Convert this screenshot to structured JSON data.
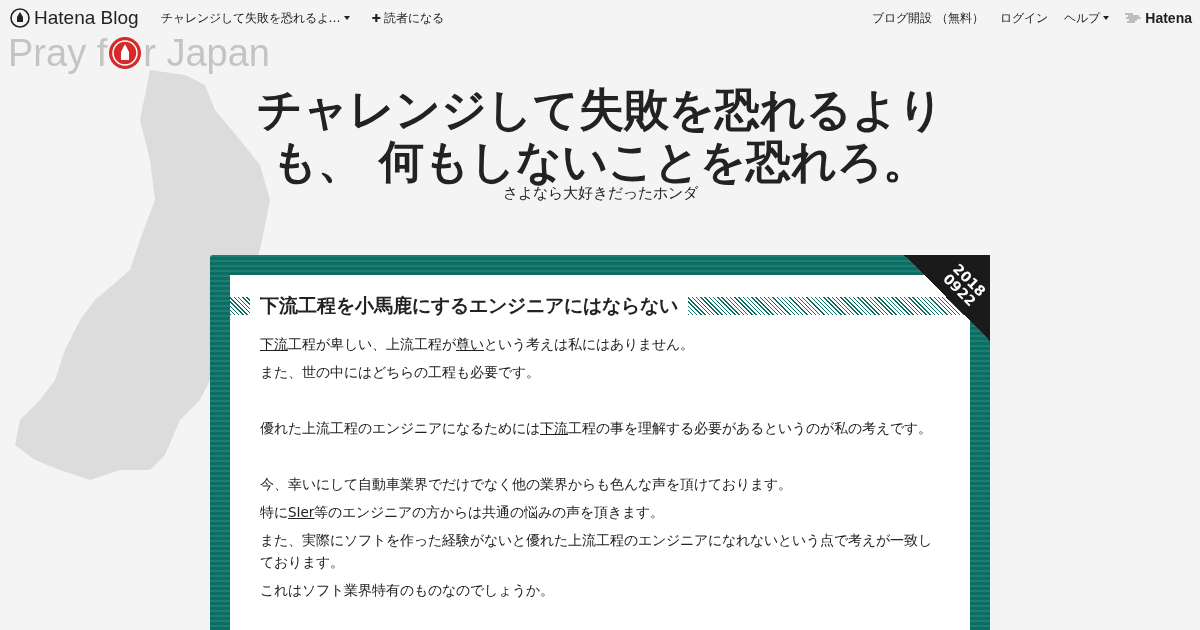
{
  "topbar": {
    "brand": "Hatena Blog",
    "blog_menu": "チャレンジして失敗を恐れるよ…",
    "subscribe_icon": "✚",
    "subscribe": "読者になる",
    "right_links": [
      "ブログ開設 （無料）",
      "ログイン"
    ],
    "help": "ヘルプ",
    "hatena": "Hatena"
  },
  "pray_logo": {
    "before": "Pray f",
    "after": "r Japan"
  },
  "blog_title": "チャレンジして失敗を恐れるよりも、 何もしないことを恐れろ。",
  "blog_description": "さよなら大好きだったホンダ",
  "entry": {
    "date_year": "2018",
    "date_day": "0922",
    "title": "下流工程を小馬鹿にするエンジニアにはならない",
    "paragraphs": [
      {
        "kind": "text",
        "parts": [
          {
            "text": "下流",
            "kind": "link"
          },
          {
            "text": "工程が卑しい、上流工程が",
            "kind": "plain"
          },
          {
            "text": "尊い",
            "kind": "link"
          },
          {
            "text": "という考えは私にはありません。",
            "kind": "plain"
          }
        ]
      },
      {
        "kind": "text",
        "parts": [
          {
            "text": "また、世の中にはどちらの工程も必要です。",
            "kind": "plain"
          }
        ]
      },
      {
        "kind": "blank"
      },
      {
        "kind": "text",
        "parts": [
          {
            "text": "優れた上流工程のエンジニアになるためには",
            "kind": "plain"
          },
          {
            "text": "下流",
            "kind": "link"
          },
          {
            "text": "工程の事を理解する必要があるというのが私の考えです。",
            "kind": "plain"
          }
        ]
      },
      {
        "kind": "blank"
      },
      {
        "kind": "text",
        "parts": [
          {
            "text": "今、幸いにして自動車業界でだけでなく他の業界からも色んな声を頂けております。",
            "kind": "plain"
          }
        ]
      },
      {
        "kind": "text",
        "parts": [
          {
            "text": "特に",
            "kind": "plain"
          },
          {
            "text": "SIer",
            "kind": "link"
          },
          {
            "text": "等のエンジニアの方からは共通の悩みの声を頂きます。",
            "kind": "plain"
          }
        ]
      },
      {
        "kind": "text",
        "parts": [
          {
            "text": "また、実際にソフトを作った経験がないと優れた上流工程のエンジニアになれないという点で考えが一致しております。",
            "kind": "plain"
          }
        ]
      },
      {
        "kind": "text",
        "parts": [
          {
            "text": "これはソフト業界特有のものなのでしょうか。",
            "kind": "plain"
          }
        ]
      }
    ]
  }
}
